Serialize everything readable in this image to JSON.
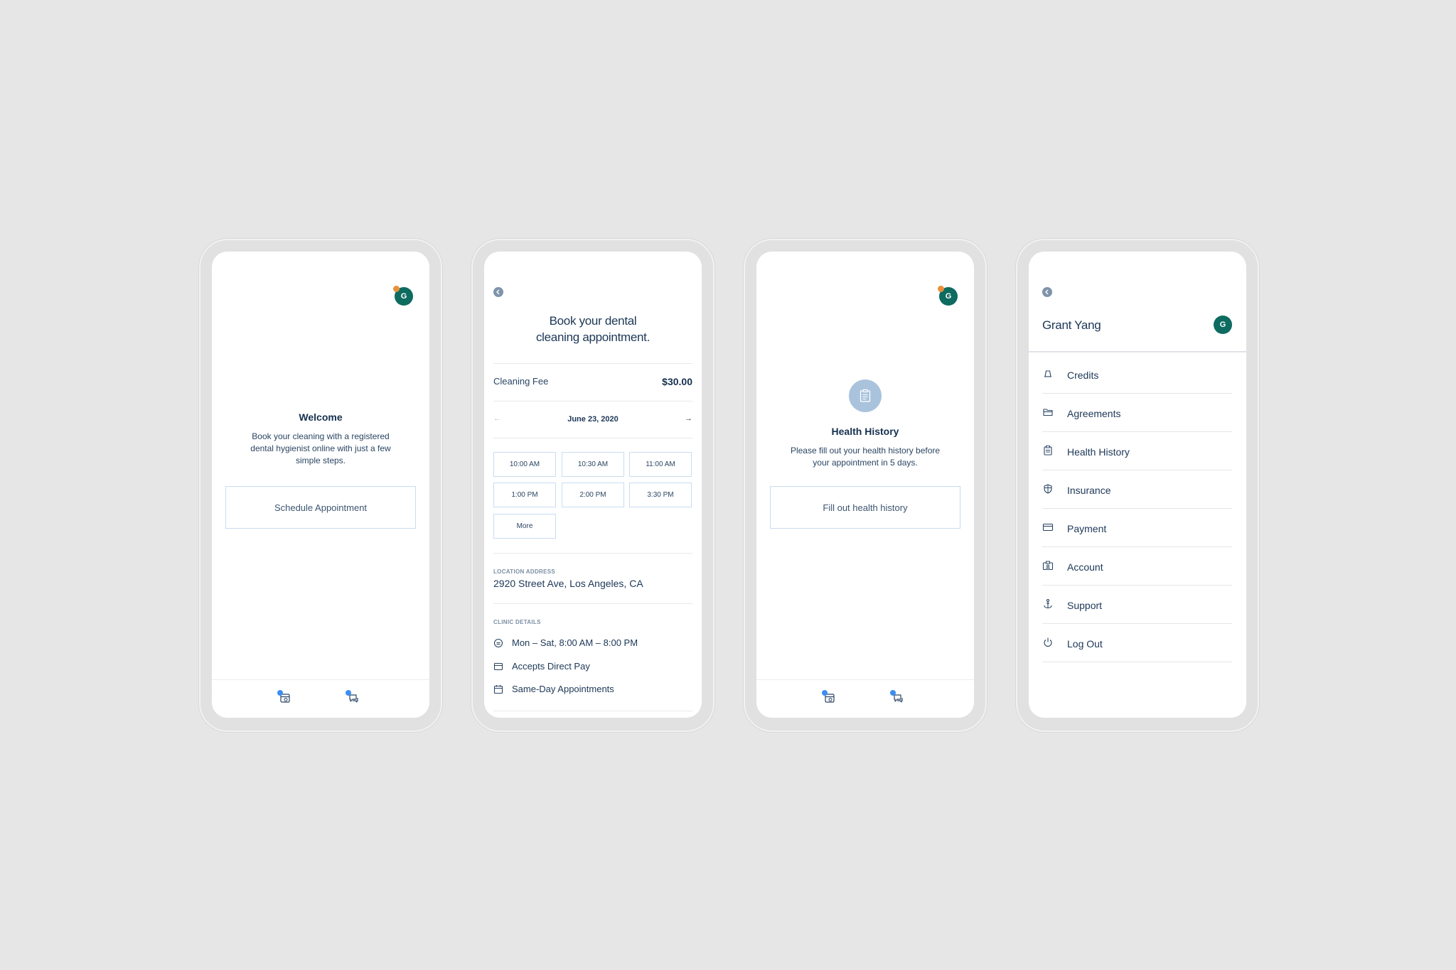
{
  "user": {
    "initial": "G",
    "name": "Grant Yang"
  },
  "welcome": {
    "title": "Welcome",
    "text": "Book your cleaning with a registered dental hygienist online with just a few simple steps.",
    "button": "Schedule Appointment"
  },
  "booking": {
    "title_line1": "Book your dental",
    "title_line2": "cleaning appointment.",
    "fee_label": "Cleaning Fee",
    "fee_value": "$30.00",
    "date": "June 23, 2020",
    "arrow_prev": "←",
    "arrow_next": "→",
    "slots": [
      "10:00 AM",
      "10:30 AM",
      "11:00 AM",
      "1:00 PM",
      "2:00 PM",
      "3:30 PM",
      "More"
    ],
    "location_label": "LOCATION ADDRESS",
    "location": "2920 Street Ave, Los Angeles, CA",
    "clinic_label": "CLINIC DETAILS",
    "details": [
      "Mon – Sat, 8:00 AM – 8:00 PM",
      "Accepts Direct Pay",
      "Same-Day Appointments"
    ]
  },
  "health": {
    "title": "Health History",
    "text": "Please fill out your health history before your appointment in 5 days.",
    "button": "Fill out health history"
  },
  "menu": {
    "items": [
      "Credits",
      "Agreements",
      "Health History",
      "Insurance",
      "Payment",
      "Account",
      "Support",
      "Log Out"
    ],
    "icons": [
      "bell-icon",
      "folder-icon",
      "clipboard-icon",
      "shield-icon",
      "credit-card-icon",
      "id-card-icon",
      "anchor-icon",
      "power-icon"
    ]
  },
  "colors": {
    "avatar": "#0e6b60",
    "notification": "#e8903a",
    "accent": "#3c8ef0",
    "border": "#c9dcf0"
  }
}
